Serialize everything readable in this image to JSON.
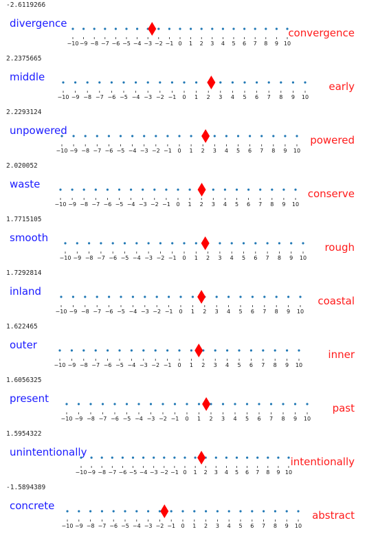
{
  "chart_data": [
    {
      "type": "scatter",
      "score_text": "-2.6119266",
      "value": -2.6119266,
      "left_label": "divergence",
      "right_label": "convergence",
      "xlim": [
        -10,
        10
      ],
      "ticks": [
        "−10",
        "−9",
        "−8",
        "−7",
        "−6",
        "−5",
        "−4",
        "−3",
        "−2",
        "−1",
        "0",
        "1",
        "2",
        "3",
        "4",
        "5",
        "6",
        "7",
        "8",
        "9",
        "10"
      ],
      "dot_color": "#1f77b4",
      "marker_color": "#ff0000"
    },
    {
      "type": "scatter",
      "score_text": "2.2375665",
      "value": 2.2375665,
      "left_label": "middle",
      "right_label": "early",
      "xlim": [
        -10,
        10
      ],
      "ticks": [
        "−10",
        "−9",
        "−8",
        "−7",
        "−6",
        "−5",
        "−4",
        "−3",
        "−2",
        "−1",
        "0",
        "1",
        "2",
        "3",
        "4",
        "5",
        "6",
        "7",
        "8",
        "9",
        "10"
      ],
      "dot_color": "#1f77b4",
      "marker_color": "#ff0000"
    },
    {
      "type": "scatter",
      "score_text": "2.2293124",
      "value": 2.2293124,
      "left_label": "unpowered",
      "right_label": "powered",
      "xlim": [
        -10,
        10
      ],
      "ticks": [
        "−10",
        "−9",
        "−8",
        "−7",
        "−6",
        "−5",
        "−4",
        "−3",
        "−2",
        "−1",
        "0",
        "1",
        "2",
        "3",
        "4",
        "5",
        "6",
        "7",
        "8",
        "9",
        "10"
      ],
      "dot_color": "#1f77b4",
      "marker_color": "#ff0000"
    },
    {
      "type": "scatter",
      "score_text": "2.020052",
      "value": 2.020052,
      "left_label": "waste",
      "right_label": "conserve",
      "xlim": [
        -10,
        10
      ],
      "ticks": [
        "−10",
        "−9",
        "−8",
        "−7",
        "−6",
        "−5",
        "−4",
        "−3",
        "−2",
        "−1",
        "0",
        "1",
        "2",
        "3",
        "4",
        "5",
        "6",
        "7",
        "8",
        "9",
        "10"
      ],
      "dot_color": "#1f77b4",
      "marker_color": "#ff0000"
    },
    {
      "type": "scatter",
      "score_text": "1.7715105",
      "value": 1.7715105,
      "left_label": "smooth",
      "right_label": "rough",
      "xlim": [
        -10,
        10
      ],
      "ticks": [
        "−10",
        "−9",
        "−8",
        "−7",
        "−6",
        "−5",
        "−4",
        "−3",
        "−2",
        "−1",
        "0",
        "1",
        "2",
        "3",
        "4",
        "5",
        "6",
        "7",
        "8",
        "9",
        "10"
      ],
      "dot_color": "#1f77b4",
      "marker_color": "#ff0000"
    },
    {
      "type": "scatter",
      "score_text": "1.7292814",
      "value": 1.7292814,
      "left_label": "inland",
      "right_label": "coastal",
      "xlim": [
        -10,
        10
      ],
      "ticks": [
        "−10",
        "−9",
        "−8",
        "−7",
        "−6",
        "−5",
        "−4",
        "−3",
        "−2",
        "−1",
        "0",
        "1",
        "2",
        "3",
        "4",
        "5",
        "6",
        "7",
        "8",
        "9",
        "10"
      ],
      "dot_color": "#1f77b4",
      "marker_color": "#ff0000"
    },
    {
      "type": "scatter",
      "score_text": "1.622465",
      "value": 1.622465,
      "left_label": "outer",
      "right_label": "inner",
      "xlim": [
        -10,
        10
      ],
      "ticks": [
        "−10",
        "−9",
        "−8",
        "−7",
        "−6",
        "−5",
        "−4",
        "−3",
        "−2",
        "−1",
        "0",
        "1",
        "2",
        "3",
        "4",
        "5",
        "6",
        "7",
        "8",
        "9",
        "10"
      ],
      "dot_color": "#1f77b4",
      "marker_color": "#ff0000"
    },
    {
      "type": "scatter",
      "score_text": "1.6056325",
      "value": 1.6056325,
      "left_label": "present",
      "right_label": "past",
      "xlim": [
        -10,
        10
      ],
      "ticks": [
        "−10",
        "−9",
        "−8",
        "−7",
        "−6",
        "−5",
        "−4",
        "−3",
        "−2",
        "−1",
        "0",
        "1",
        "2",
        "3",
        "4",
        "5",
        "6",
        "7",
        "8",
        "9",
        "10"
      ],
      "dot_color": "#1f77b4",
      "marker_color": "#ff0000"
    },
    {
      "type": "scatter",
      "score_text": "1.5954322",
      "value": 1.5954322,
      "left_label": "unintentionally",
      "right_label": "intentionally",
      "xlim": [
        -10,
        10
      ],
      "ticks": [
        "−10",
        "−9",
        "−8",
        "−7",
        "−6",
        "−5",
        "−4",
        "−3",
        "−2",
        "−1",
        "0",
        "1",
        "2",
        "3",
        "4",
        "5",
        "6",
        "7",
        "8",
        "9",
        "10"
      ],
      "dot_color": "#1f77b4",
      "marker_color": "#ff0000"
    },
    {
      "type": "scatter",
      "score_text": "-1.5894389",
      "value": -1.5894389,
      "left_label": "concrete",
      "right_label": "abstract",
      "xlim": [
        -10,
        10
      ],
      "ticks": [
        "−10",
        "−9",
        "−8",
        "−7",
        "−6",
        "−5",
        "−4",
        "−3",
        "−2",
        "−1",
        "0",
        "1",
        "2",
        "3",
        "4",
        "5",
        "6",
        "7",
        "8",
        "9",
        "10"
      ],
      "dot_color": "#1f77b4",
      "marker_color": "#ff0000"
    }
  ]
}
